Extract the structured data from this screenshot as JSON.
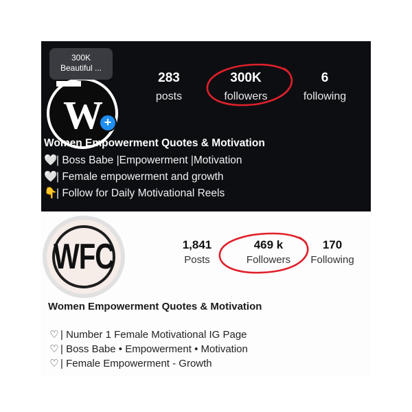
{
  "top_profile": {
    "tooltip_line1": "300K",
    "tooltip_line2": "Beautiful ...",
    "avatar_letter": "W",
    "add_icon": "+",
    "posts_count": "283",
    "posts_label": "posts",
    "followers_count": "300K",
    "followers_label": "followers",
    "following_count": "6",
    "following_label": "following",
    "name": "Women Empowerment Quotes & Motivation",
    "bio": [
      {
        "icon": "🤍",
        "text": "| Boss Babe |Empowerment |Motivation"
      },
      {
        "icon": "🤍",
        "text": "| Female empowerment and growth"
      },
      {
        "icon": "👇",
        "text": "| Follow for Daily Motivational Reels"
      }
    ]
  },
  "bottom_profile": {
    "avatar_text": "WFC",
    "posts_count": "1,841",
    "posts_label": "Posts",
    "followers_count": "469 k",
    "followers_label": "Followers",
    "following_count": "170",
    "following_label": "Following",
    "name": "Women Empowerment Quotes & Motivation",
    "bio": [
      {
        "icon": "♡",
        "text": "| Number 1 Female Motivational IG Page"
      },
      {
        "icon": "♡",
        "text": "| Boss Babe • Empowerment • Motivation"
      },
      {
        "icon": "♡",
        "text": "| Female Empowerment - Growth"
      }
    ]
  },
  "colors": {
    "dark_bg": "#0d0e12",
    "highlight_circle": "#e0202a",
    "add_badge": "#1f8ff2"
  }
}
